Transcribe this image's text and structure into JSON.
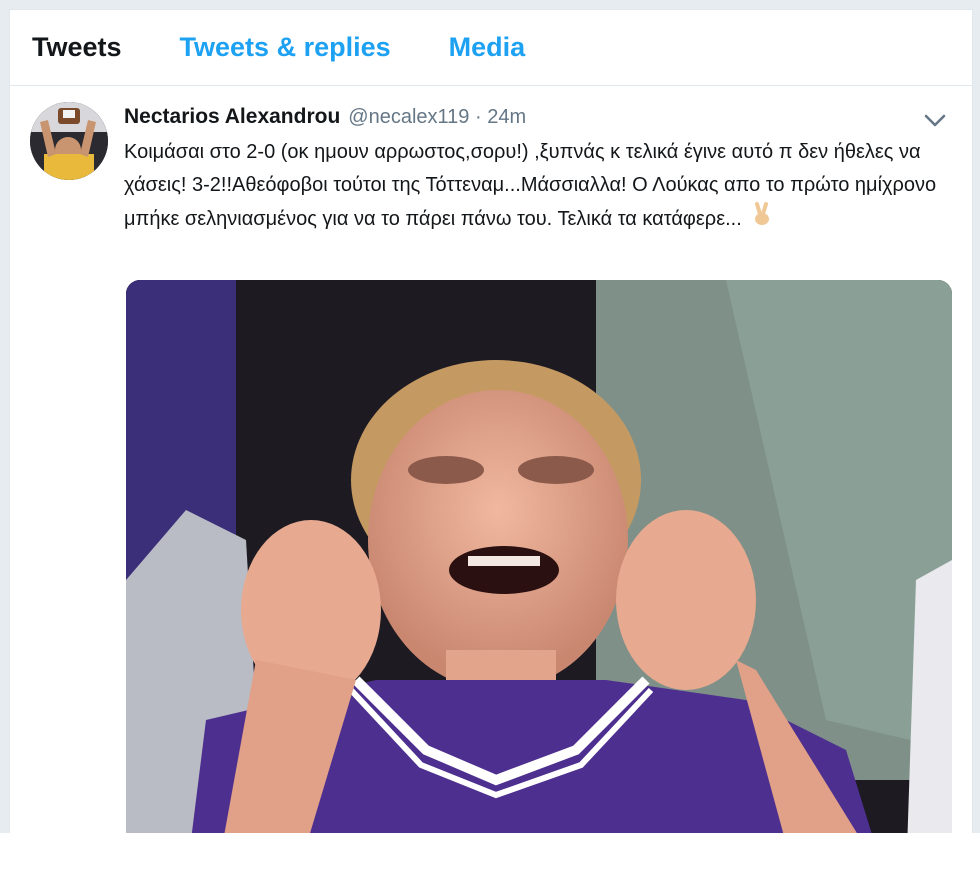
{
  "tabs": [
    {
      "label": "Tweets",
      "active": true
    },
    {
      "label": "Tweets & replies",
      "active": false
    },
    {
      "label": "Media",
      "active": false
    }
  ],
  "tweet": {
    "author_name": "Nectarios Alexandrou",
    "handle_time": "@necalex119 · 24m",
    "text": "Κοιμάσαι στο 2-0 (οκ ημουν αρρωστος,σορυ!) ,ξυπνάς κ τελικά έγινε αυτό π δεν ήθελες να χάσεις! 3-2!!Αθεόφοβοι τούτοι της Τόττεναμ...Μάσσιαλλα! Ο Λούκας απο το πρώτο ημίχρονο μπήκε σεληνιασμένος για να το πάρει πάνω του. Τελικά τα κατάφερε...",
    "emoji": "victory-hand",
    "media": {
      "type": "image",
      "description_icon": "photo"
    }
  },
  "colors": {
    "accent": "#1da1f2",
    "text": "#14171a",
    "muted": "#657786",
    "border": "#e1e8ed",
    "background": "#e6ecf0"
  }
}
